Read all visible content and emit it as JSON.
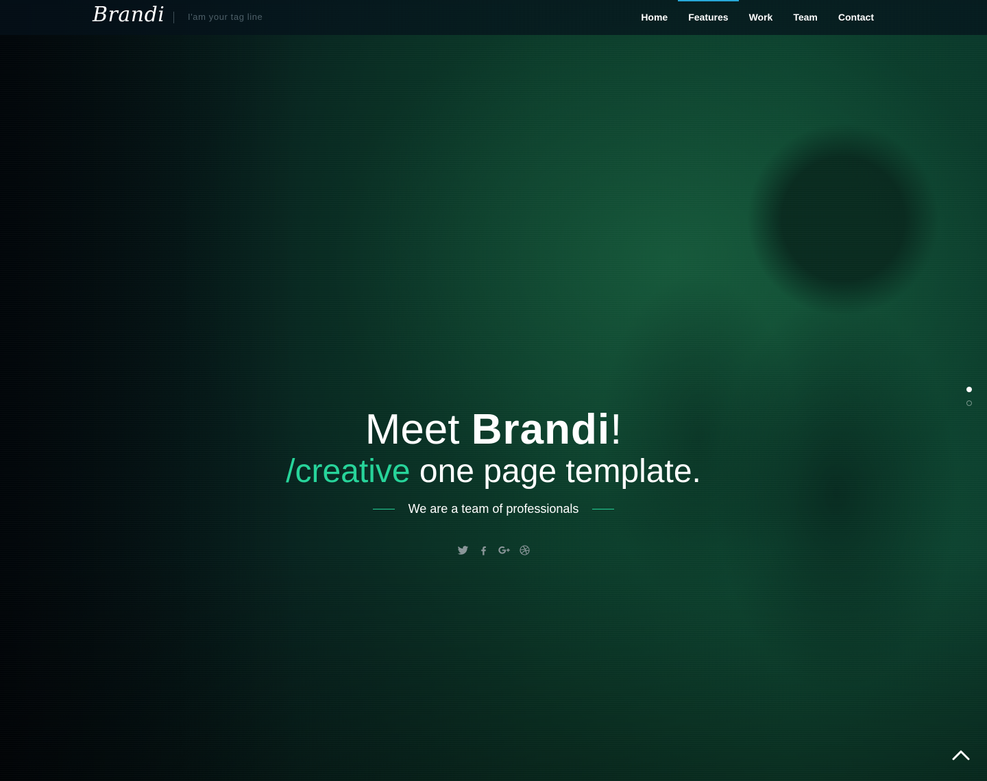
{
  "header": {
    "logo_text": "Brandi",
    "tagline": "I'am your tag line"
  },
  "nav": {
    "items": [
      {
        "label": "Home",
        "active": false
      },
      {
        "label": "Features",
        "active": true
      },
      {
        "label": "Work",
        "active": false
      },
      {
        "label": "Team",
        "active": false
      },
      {
        "label": "Contact",
        "active": false
      }
    ]
  },
  "hero": {
    "headline_prefix": "Meet ",
    "headline_brand": "Brandi",
    "headline_suffix": "!",
    "sub_accent": "/creative",
    "sub_rest": " one page template.",
    "tagline": "We are a team of professionals"
  },
  "social": {
    "icons": [
      "twitter-icon",
      "facebook-icon",
      "google-plus-icon",
      "dribbble-icon"
    ]
  },
  "slider": {
    "slide_count": 2,
    "active_index": 0
  },
  "colors": {
    "accent": "#27d49a",
    "nav_active_bar": "#27a8d8",
    "text": "#ffffff"
  }
}
